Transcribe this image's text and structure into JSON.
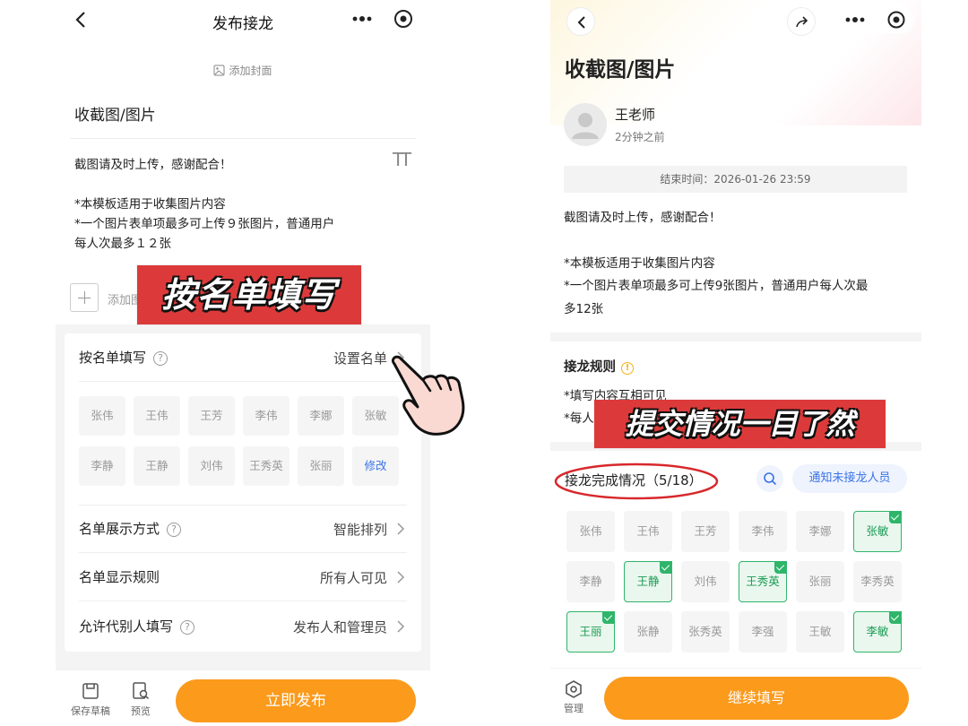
{
  "left": {
    "header": {
      "title": "发布接龙"
    },
    "cover": {
      "label": "添加封面"
    },
    "doc_title": "收截图/图片",
    "description": [
      "截图请及时上传，感谢配合！",
      "",
      "*本模板适用于收集图片内容",
      "*一个图片表单项最多可上传９张图片，普通用户",
      "每人次最多１２张"
    ],
    "add_item_label": "添加图",
    "settings": {
      "roster": {
        "label": "按名单填写",
        "help": "?",
        "value": "设置名单"
      },
      "display_mode": {
        "label": "名单展示方式",
        "help": "?",
        "value": "智能排列"
      },
      "display_rule": {
        "label": "名单显示规则",
        "value": "所有人可见"
      },
      "proxy_fill": {
        "label": "允许代别人填写",
        "help": "?",
        "value": "发布人和管理员"
      }
    },
    "names": [
      "张伟",
      "王伟",
      "王芳",
      "李伟",
      "李娜",
      "张敏",
      "李静",
      "王静",
      "刘伟",
      "王秀英",
      "张丽"
    ],
    "edit_label": "修改",
    "bottom": {
      "save_draft": "保存草稿",
      "preview": "预览",
      "publish": "立即发布"
    }
  },
  "right": {
    "title": "收截图/图片",
    "author": "王老师",
    "posted": "2分钟之前",
    "deadline": "结束时间：2026-01-26 23:59",
    "description": [
      "截图请及时上传，感谢配合！",
      "",
      "*本模板适用于收集图片内容",
      "*一个图片表单项最多可上传9张图片，普通用户每人次最",
      "多12张"
    ],
    "rules": {
      "title": "接龙规则",
      "lines": [
        "*填写内容互相可见",
        "*每人"
      ]
    },
    "progress": "接龙完成情况（5/18）",
    "notify_label": "通知未接龙人员",
    "names": [
      {
        "name": "张伟",
        "done": false
      },
      {
        "name": "王伟",
        "done": false
      },
      {
        "name": "王芳",
        "done": false
      },
      {
        "name": "李伟",
        "done": false
      },
      {
        "name": "李娜",
        "done": false
      },
      {
        "name": "张敏",
        "done": true
      },
      {
        "name": "李静",
        "done": false
      },
      {
        "name": "王静",
        "done": true
      },
      {
        "name": "刘伟",
        "done": false
      },
      {
        "name": "王秀英",
        "done": true
      },
      {
        "name": "张丽",
        "done": false
      },
      {
        "name": "李秀英",
        "done": false
      },
      {
        "name": "王丽",
        "done": true
      },
      {
        "name": "张静",
        "done": false
      },
      {
        "name": "张秀英",
        "done": false
      },
      {
        "name": "李强",
        "done": false
      },
      {
        "name": "王敏",
        "done": false
      },
      {
        "name": "李敏",
        "done": true
      }
    ],
    "bottom": {
      "manage": "管理",
      "continue": "继续填写"
    }
  },
  "overlays": {
    "banner_left": "按名单填写",
    "banner_right": "提交情况一目了然"
  },
  "colors": {
    "accent_orange": "#fb9a1b",
    "banner_red": "#dc3a3a",
    "done_green": "#2fb56a",
    "link_blue": "#3a73e8"
  }
}
